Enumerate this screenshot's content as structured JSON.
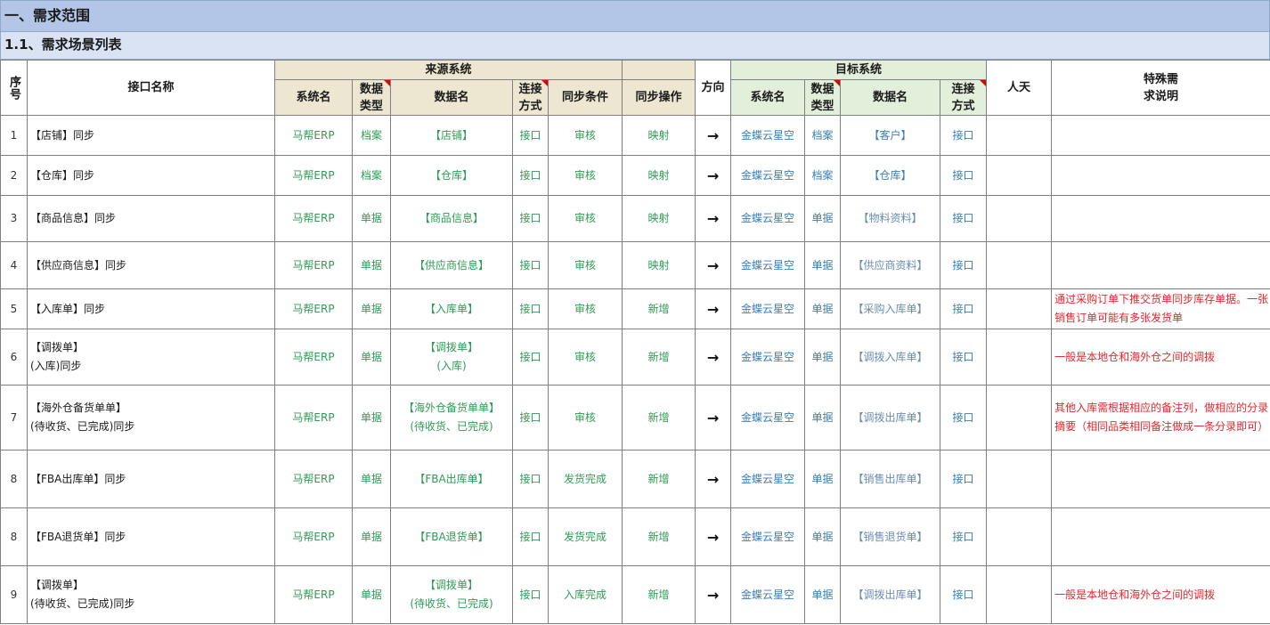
{
  "section_title": "一、需求范围",
  "subsection_title": "1.1、需求场景列表",
  "headers": {
    "index": "序号",
    "interface_name": "接口名称",
    "source_group": "来源系统",
    "target_group": "目标系统",
    "direction": "方向",
    "man_days": "人天",
    "special": "特殊需求说明",
    "sys_name": "系统名",
    "data_type": "数据类型",
    "data_name": "数据名",
    "conn": "连接方式",
    "sync_cond": "同步条件",
    "sync_op": "同步操作"
  },
  "rows": [
    {
      "idx": "1",
      "name_l1": "【店铺】同步",
      "name_l2": "",
      "src_sys": "马帮ERP",
      "src_type": "档案",
      "src_data_l1": "【店铺】",
      "src_data_l2": "",
      "src_conn": "接口",
      "cond": "审核",
      "op": "映射",
      "dir": "→",
      "tgt_sys": "金蝶云星空",
      "tgt_type": "档案",
      "tgt_data": "【客户】",
      "tgt_conn": "接口",
      "note": ""
    },
    {
      "idx": "2",
      "name_l1": "【仓库】同步",
      "name_l2": "",
      "src_sys": "马帮ERP",
      "src_type": "档案",
      "src_data_l1": "【仓库】",
      "src_data_l2": "",
      "src_conn": "接口",
      "cond": "审核",
      "op": "映射",
      "dir": "→",
      "tgt_sys": "金蝶云星空",
      "tgt_type": "档案",
      "tgt_data": "【仓库】",
      "tgt_conn": "接口",
      "note": ""
    },
    {
      "idx": "3",
      "name_l1": "【商品信息】同步",
      "name_l2": "",
      "src_sys": "马帮ERP",
      "src_type": "单据",
      "src_data_l1": "【商品信息】",
      "src_data_l2": "",
      "src_conn": "接口",
      "cond": "审核",
      "op": "映射",
      "dir": "→",
      "tgt_sys": "金蝶云星空",
      "tgt_type": "单据",
      "tgt_data": "【物料资料】",
      "tgt_conn": "接口",
      "note": ""
    },
    {
      "idx": "4",
      "name_l1": "【供应商信息】同步",
      "name_l2": "",
      "src_sys": "马帮ERP",
      "src_type": "单据",
      "src_data_l1": "【供应商信息】",
      "src_data_l2": "",
      "src_conn": "接口",
      "cond": "审核",
      "op": "映射",
      "dir": "→",
      "tgt_sys": "金蝶云星空",
      "tgt_type": "单据",
      "tgt_data": "【供应商资料】",
      "tgt_conn": "接口",
      "note": ""
    },
    {
      "idx": "5",
      "name_l1": "【入库单】同步",
      "name_l2": "",
      "src_sys": "马帮ERP",
      "src_type": "单据",
      "src_data_l1": "【入库单】",
      "src_data_l2": "",
      "src_conn": "接口",
      "cond": "审核",
      "op": "新增",
      "dir": "→",
      "tgt_sys": "金蝶云星空",
      "tgt_type": "单据",
      "tgt_data": "【采购入库单】",
      "tgt_conn": "接口",
      "note": "通过采购订单下推交货单同步库存单据。一张销售订单可能有多张发货单"
    },
    {
      "idx": "6",
      "name_l1": "【调拨单】",
      "name_l2": "(入库)同步",
      "src_sys": "马帮ERP",
      "src_type": "单据",
      "src_data_l1": "【调拨单】",
      "src_data_l2": "(入库)",
      "src_conn": "接口",
      "cond": "审核",
      "op": "新增",
      "dir": "→",
      "tgt_sys": "金蝶云星空",
      "tgt_type": "单据",
      "tgt_data": "【调拨入库单】",
      "tgt_conn": "接口",
      "note": "一般是本地仓和海外仓之间的调拨"
    },
    {
      "idx": "7",
      "name_l1": "【海外仓备货单单】",
      "name_l2": "(待收货、已完成)同步",
      "src_sys": "马帮ERP",
      "src_type": "单据",
      "src_data_l1": "【海外仓备货单单】",
      "src_data_l2": "(待收货、已完成)",
      "src_conn": "接口",
      "cond": "审核",
      "op": "新增",
      "dir": "→",
      "tgt_sys": "金蝶云星空",
      "tgt_type": "单据",
      "tgt_data": "【调拨出库单】",
      "tgt_conn": "接口",
      "note": "其他入库需根据相应的备注列，做相应的分录摘要（相同品类相同备注做成一条分录即可）"
    },
    {
      "idx": "8",
      "name_l1": "【FBA出库单】同步",
      "name_l2": "",
      "src_sys": "马帮ERP",
      "src_type": "单据",
      "src_data_l1": "【FBA出库单】",
      "src_data_l2": "",
      "src_conn": "接口",
      "cond": "发货完成",
      "op": "新增",
      "dir": "→",
      "tgt_sys": "金蝶云星空",
      "tgt_type": "单据",
      "tgt_data": "【销售出库单】",
      "tgt_conn": "接口",
      "note": ""
    },
    {
      "idx": "8",
      "name_l1": "【FBA退货单】同步",
      "name_l2": "",
      "src_sys": "马帮ERP",
      "src_type": "单据",
      "src_data_l1": "【FBA退货单】",
      "src_data_l2": "",
      "src_conn": "接口",
      "cond": "发货完成",
      "op": "新增",
      "dir": "→",
      "tgt_sys": "金蝶云星空",
      "tgt_type": "单据",
      "tgt_data": "【销售退货单】",
      "tgt_conn": "接口",
      "note": ""
    },
    {
      "idx": "9",
      "name_l1": "【调拨单】",
      "name_l2": "(待收货、已完成)同步",
      "src_sys": "马帮ERP",
      "src_type": "单据",
      "src_data_l1": "【调拨单】",
      "src_data_l2": "(待收货、已完成)",
      "src_conn": "接口",
      "cond": "入库完成",
      "op": "新增",
      "dir": "→",
      "tgt_sys": "金蝶云星空",
      "tgt_type": "单据",
      "tgt_data": "【调拨出库单】",
      "tgt_conn": "接口",
      "note": "一般是本地仓和海外仓之间的调拨"
    }
  ]
}
